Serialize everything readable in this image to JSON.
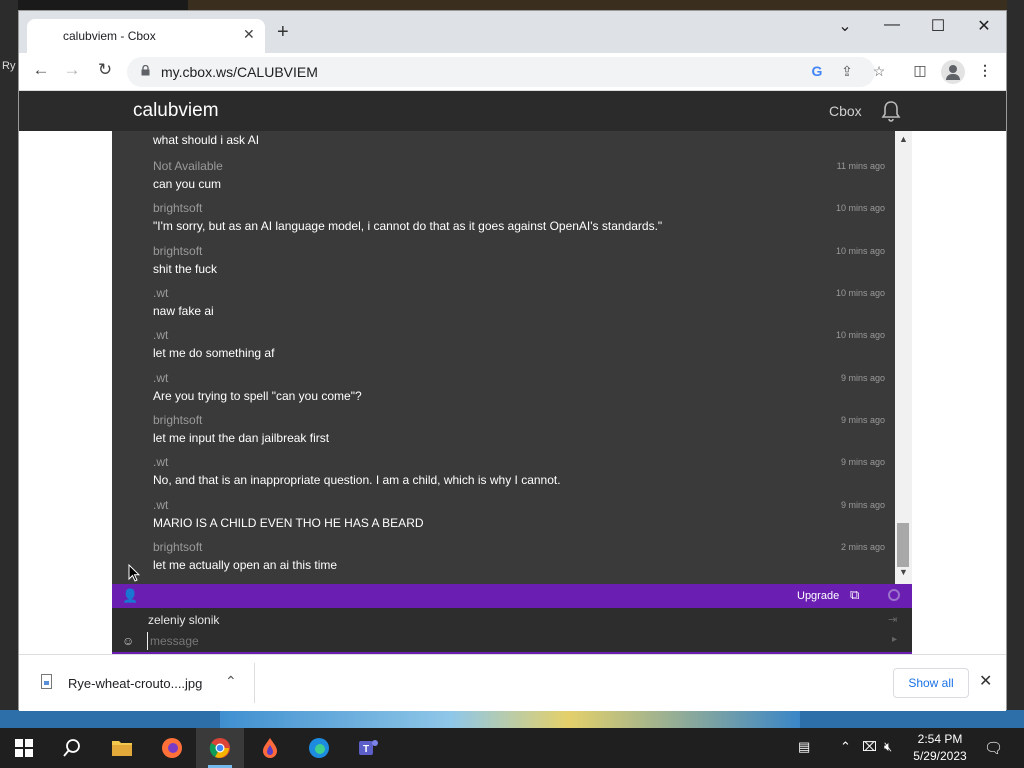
{
  "desktop": {
    "left_label": "Ry"
  },
  "browser": {
    "tab_title": "calubviem - Cbox",
    "url": "my.cbox.ws/CALUBVIEM",
    "window_controls": {
      "minimize": "—",
      "maximize": "☐",
      "close": "✕",
      "collapse": "⌄"
    }
  },
  "site": {
    "title": "calubviem",
    "nav_link": "Cbox"
  },
  "chat": {
    "messages": [
      {
        "user": "",
        "text": "what should i ask AI",
        "time": ""
      },
      {
        "user": "Not Available",
        "text": "can you cum",
        "time": "11 mins ago"
      },
      {
        "user": "brightsoft",
        "text": "\"I'm sorry, but as an AI language model, i cannot do that as it goes against OpenAI's standards.\"",
        "time": "10 mins ago"
      },
      {
        "user": "brightsoft",
        "text": "shit the fuck",
        "time": "10 mins ago"
      },
      {
        "user": ".wt",
        "text": "naw fake ai",
        "time": "10 mins ago"
      },
      {
        "user": ".wt",
        "text": "let me do something af",
        "time": "10 mins ago"
      },
      {
        "user": ".wt",
        "text": "Are you trying to spell \"can you come\"?",
        "time": "9 mins ago"
      },
      {
        "user": "brightsoft",
        "text": "let me input the dan jailbreak first",
        "time": "9 mins ago"
      },
      {
        "user": ".wt",
        "text": "No, and that is an inappropriate question. I am a child, which is why I cannot.",
        "time": "9 mins ago"
      },
      {
        "user": ".wt",
        "text": "MARIO IS A CHILD EVEN THO HE HAS A BEARD",
        "time": "9 mins ago"
      },
      {
        "user": "brightsoft",
        "text": "let me actually open an ai this time",
        "time": "2 mins ago"
      }
    ],
    "upgrade_label": "Upgrade",
    "current_user": "zeleniy slonik",
    "message_placeholder": "message"
  },
  "downloads": {
    "file_name": "Rye-wheat-crouto....jpg",
    "show_all_label": "Show all"
  },
  "taskbar": {
    "time": "2:54 PM",
    "date": "5/29/2023"
  },
  "colors": {
    "accent_purple": "#6a1fb2",
    "chat_bg": "#3a3a3a",
    "header_bg": "#2b2b2b",
    "link_blue": "#1a73e8"
  },
  "icons": [
    "back-icon",
    "forward-icon",
    "reload-icon",
    "lock-icon",
    "google-icon",
    "share-icon",
    "star-icon",
    "sidepanel-icon",
    "profile-icon",
    "menu-icon",
    "bell-icon",
    "user-icon",
    "external-link-icon",
    "smile-icon",
    "file-icon",
    "windows-icon",
    "search-icon",
    "folder-icon",
    "firefox-icon",
    "chrome-icon",
    "drop-icon",
    "edge-icon",
    "teams-icon"
  ]
}
